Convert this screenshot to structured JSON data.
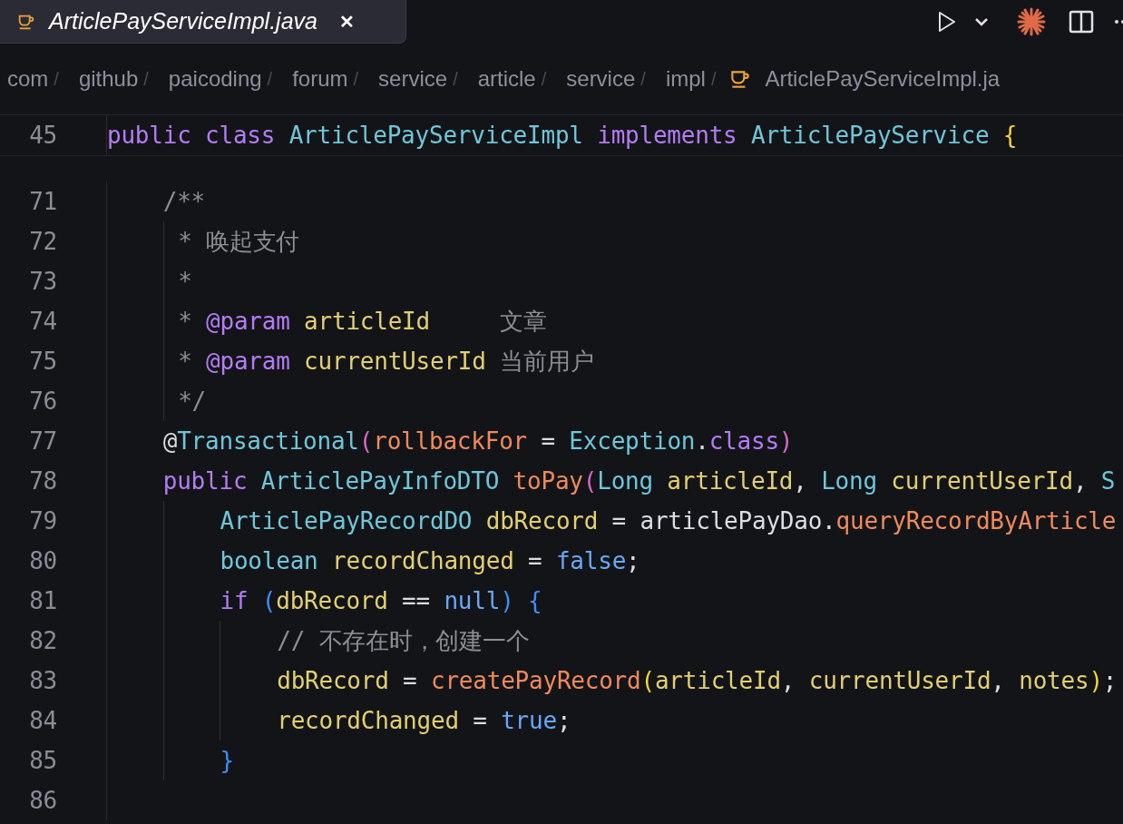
{
  "tab": {
    "title": "ArticlePayServiceImpl.java",
    "close": "✕",
    "selected": true
  },
  "breadcrumb": [
    "com",
    "github",
    "paicoding",
    "forum",
    "service",
    "article",
    "service",
    "impl"
  ],
  "breadcrumb_separator": "/",
  "breadcrumb_file": "ArticlePayServiceImpl.ja",
  "sticky_line": {
    "number": "45",
    "tokens": [
      {
        "text": "public",
        "kind": "keyword"
      },
      {
        "text": " class",
        "kind": "keyword"
      },
      {
        "text": " ArticlePayServiceImpl",
        "kind": "type"
      },
      {
        "text": " implements",
        "kind": "keyword"
      },
      {
        "text": " ArticlePayService",
        "kind": "type"
      },
      {
        "text": " {",
        "kind": "bracket1"
      }
    ]
  },
  "lines": [
    {
      "number": "71",
      "tokens": [
        {
          "text": "    /**",
          "kind": "comment"
        }
      ]
    },
    {
      "number": "72",
      "tokens": [
        {
          "text": "     * 唤起支付",
          "kind": "comment"
        }
      ]
    },
    {
      "number": "73",
      "tokens": [
        {
          "text": "     *",
          "kind": "comment"
        }
      ]
    },
    {
      "number": "74",
      "tokens": [
        {
          "text": "     * ",
          "kind": "comment"
        },
        {
          "text": "@param",
          "kind": "keyword"
        },
        {
          "text": " articleId",
          "kind": "variable"
        },
        {
          "text": "     文章",
          "kind": "comment"
        }
      ]
    },
    {
      "number": "75",
      "tokens": [
        {
          "text": "     * ",
          "kind": "comment"
        },
        {
          "text": "@param",
          "kind": "keyword"
        },
        {
          "text": " currentUserId",
          "kind": "variable"
        },
        {
          "text": " 当前用户",
          "kind": "comment"
        }
      ]
    },
    {
      "number": "76",
      "tokens": [
        {
          "text": "     */",
          "kind": "comment"
        }
      ]
    },
    {
      "number": "77",
      "tokens": [
        {
          "text": "    @",
          "kind": "plain"
        },
        {
          "text": "Transactional",
          "kind": "type"
        },
        {
          "text": "(",
          "kind": "bracket2"
        },
        {
          "text": "rollbackFor",
          "kind": "function"
        },
        {
          "text": " = ",
          "kind": "plain"
        },
        {
          "text": "Exception",
          "kind": "type"
        },
        {
          "text": ".",
          "kind": "plain"
        },
        {
          "text": "class",
          "kind": "keyword"
        },
        {
          "text": ")",
          "kind": "bracket2"
        }
      ]
    },
    {
      "number": "78",
      "tokens": [
        {
          "text": "    public",
          "kind": "keyword"
        },
        {
          "text": " ArticlePayInfoDTO",
          "kind": "type"
        },
        {
          "text": " toPay",
          "kind": "function"
        },
        {
          "text": "(",
          "kind": "bracket2"
        },
        {
          "text": "Long",
          "kind": "type"
        },
        {
          "text": " articleId",
          "kind": "variable"
        },
        {
          "text": ", ",
          "kind": "plain"
        },
        {
          "text": "Long",
          "kind": "type"
        },
        {
          "text": " currentUserId",
          "kind": "variable"
        },
        {
          "text": ", ",
          "kind": "plain"
        },
        {
          "text": "S",
          "kind": "type"
        }
      ]
    },
    {
      "number": "79",
      "tokens": [
        {
          "text": "        ArticlePayRecordDO",
          "kind": "type"
        },
        {
          "text": " dbRecord",
          "kind": "variable"
        },
        {
          "text": " = articlePayDao.",
          "kind": "plain"
        },
        {
          "text": "queryRecordByArticle",
          "kind": "function"
        }
      ]
    },
    {
      "number": "80",
      "tokens": [
        {
          "text": "        boolean",
          "kind": "type"
        },
        {
          "text": " recordChanged",
          "kind": "variable"
        },
        {
          "text": " = ",
          "kind": "plain"
        },
        {
          "text": "false",
          "kind": "literal"
        },
        {
          "text": ";",
          "kind": "plain"
        }
      ]
    },
    {
      "number": "81",
      "tokens": [
        {
          "text": "        if",
          "kind": "keyword"
        },
        {
          "text": " (",
          "kind": "bracket3"
        },
        {
          "text": "dbRecord",
          "kind": "variable"
        },
        {
          "text": " == ",
          "kind": "plain"
        },
        {
          "text": "null",
          "kind": "literal"
        },
        {
          "text": ")",
          "kind": "bracket3"
        },
        {
          "text": " {",
          "kind": "bracket3"
        }
      ]
    },
    {
      "number": "82",
      "tokens": [
        {
          "text": "            // 不存在时，创建一个",
          "kind": "comment"
        }
      ]
    },
    {
      "number": "83",
      "tokens": [
        {
          "text": "            dbRecord",
          "kind": "variable"
        },
        {
          "text": " = ",
          "kind": "plain"
        },
        {
          "text": "createPayRecord",
          "kind": "function"
        },
        {
          "text": "(",
          "kind": "bracket1"
        },
        {
          "text": "articleId",
          "kind": "variable"
        },
        {
          "text": ", ",
          "kind": "plain"
        },
        {
          "text": "currentUserId",
          "kind": "variable"
        },
        {
          "text": ", ",
          "kind": "plain"
        },
        {
          "text": "notes",
          "kind": "variable"
        },
        {
          "text": ")",
          "kind": "bracket1"
        },
        {
          "text": ";",
          "kind": "plain"
        }
      ]
    },
    {
      "number": "84",
      "tokens": [
        {
          "text": "            recordChanged",
          "kind": "variable"
        },
        {
          "text": " = ",
          "kind": "plain"
        },
        {
          "text": "true",
          "kind": "literal"
        },
        {
          "text": ";",
          "kind": "plain"
        }
      ]
    },
    {
      "number": "85",
      "tokens": [
        {
          "text": "        }",
          "kind": "bracket3"
        }
      ]
    },
    {
      "number": "86"
    }
  ]
}
